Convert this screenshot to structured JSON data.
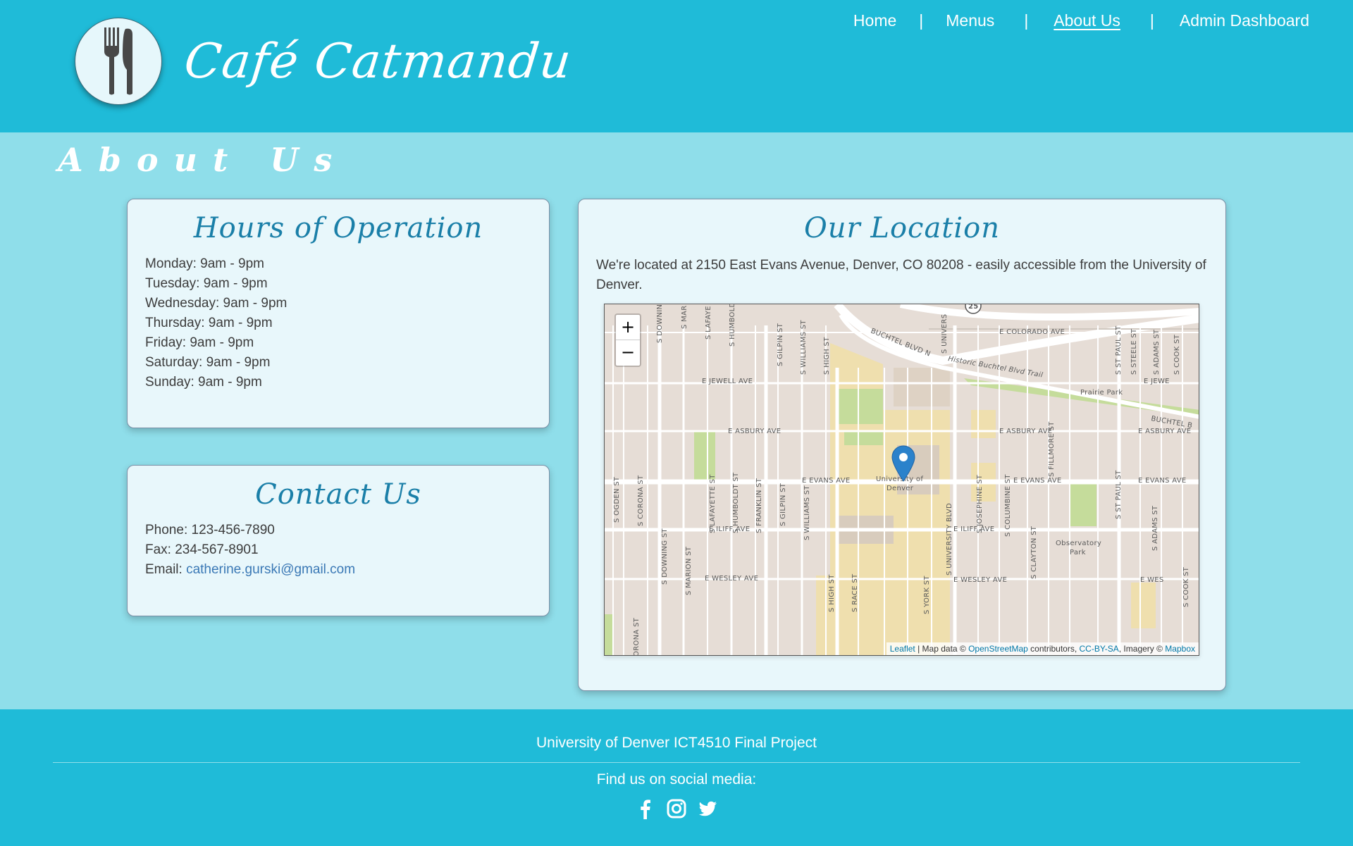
{
  "header": {
    "brand": "Café Catmandu",
    "logo_icon": "fork-knife-icon",
    "nav": [
      {
        "label": "Home",
        "active": false
      },
      {
        "label": "Menus",
        "active": false
      },
      {
        "label": "About Us",
        "active": true
      },
      {
        "label": "Admin Dashboard",
        "active": false
      }
    ],
    "separator": "|"
  },
  "page": {
    "title": "About Us"
  },
  "hours": {
    "title": "Hours of Operation",
    "items": [
      "Monday: 9am - 9pm",
      "Tuesday: 9am - 9pm",
      "Wednesday: 9am - 9pm",
      "Thursday: 9am - 9pm",
      "Friday: 9am - 9pm",
      "Saturday: 9am - 9pm",
      "Sunday: 9am - 9pm"
    ]
  },
  "contact": {
    "title": "Contact Us",
    "phone": "Phone: 123-456-7890",
    "fax": "Fax: 234-567-8901",
    "email_label": "Email: ",
    "email": "catherine.gurski@gmail.com"
  },
  "location": {
    "title": "Our Location",
    "description": "We're located at 2150 East Evans Avenue, Denver, CO 80208 - easily accessible from the University of Denver.",
    "map": {
      "zoom_in": "+",
      "zoom_out": "−",
      "marker_label": "University of Denver",
      "attribution": {
        "leaflet": "Leaflet",
        "text1": " | Map data © ",
        "osm": "OpenStreetMap",
        "text2": " contributors, ",
        "license": "CC-BY-SA",
        "text3": ", Imagery © ",
        "mapbox": "Mapbox"
      },
      "street_labels": {
        "avenues": [
          "E COLORADO AVE",
          "E JEWELL AVE",
          "E ASBURY AVE",
          "E EVANS AVE",
          "E ILIFF AVE",
          "E WESLEY AVE"
        ],
        "streets": [
          "S OGDEN ST",
          "S CORONA ST",
          "S DOWNING ST",
          "S MARION ST",
          "S LAFAYETTE ST",
          "S HUMBOLDT ST",
          "S FRANKLIN ST",
          "S GILPIN ST",
          "S WILLIAMS ST",
          "S HIGH ST",
          "S RACE ST",
          "S YORK ST",
          "S UNIVERSITY BLVD",
          "S JOSEPHINE ST",
          "S COLUMBINE ST",
          "S CLAYTON ST",
          "S FILLMORE ST",
          "S ST PAUL ST",
          "S STEELE ST",
          "S ADAMS ST",
          "S COOK ST"
        ],
        "other": [
          "BUCHTEL BLVD N",
          "Historic Buchtel Blvd Trail",
          "Prairie Park",
          "Observatory Park",
          "25"
        ]
      }
    }
  },
  "footer": {
    "project": "University of Denver ICT4510 Final Project",
    "social_label": "Find us on social media:",
    "social": [
      "facebook-icon",
      "instagram-icon",
      "twitter-icon"
    ]
  }
}
